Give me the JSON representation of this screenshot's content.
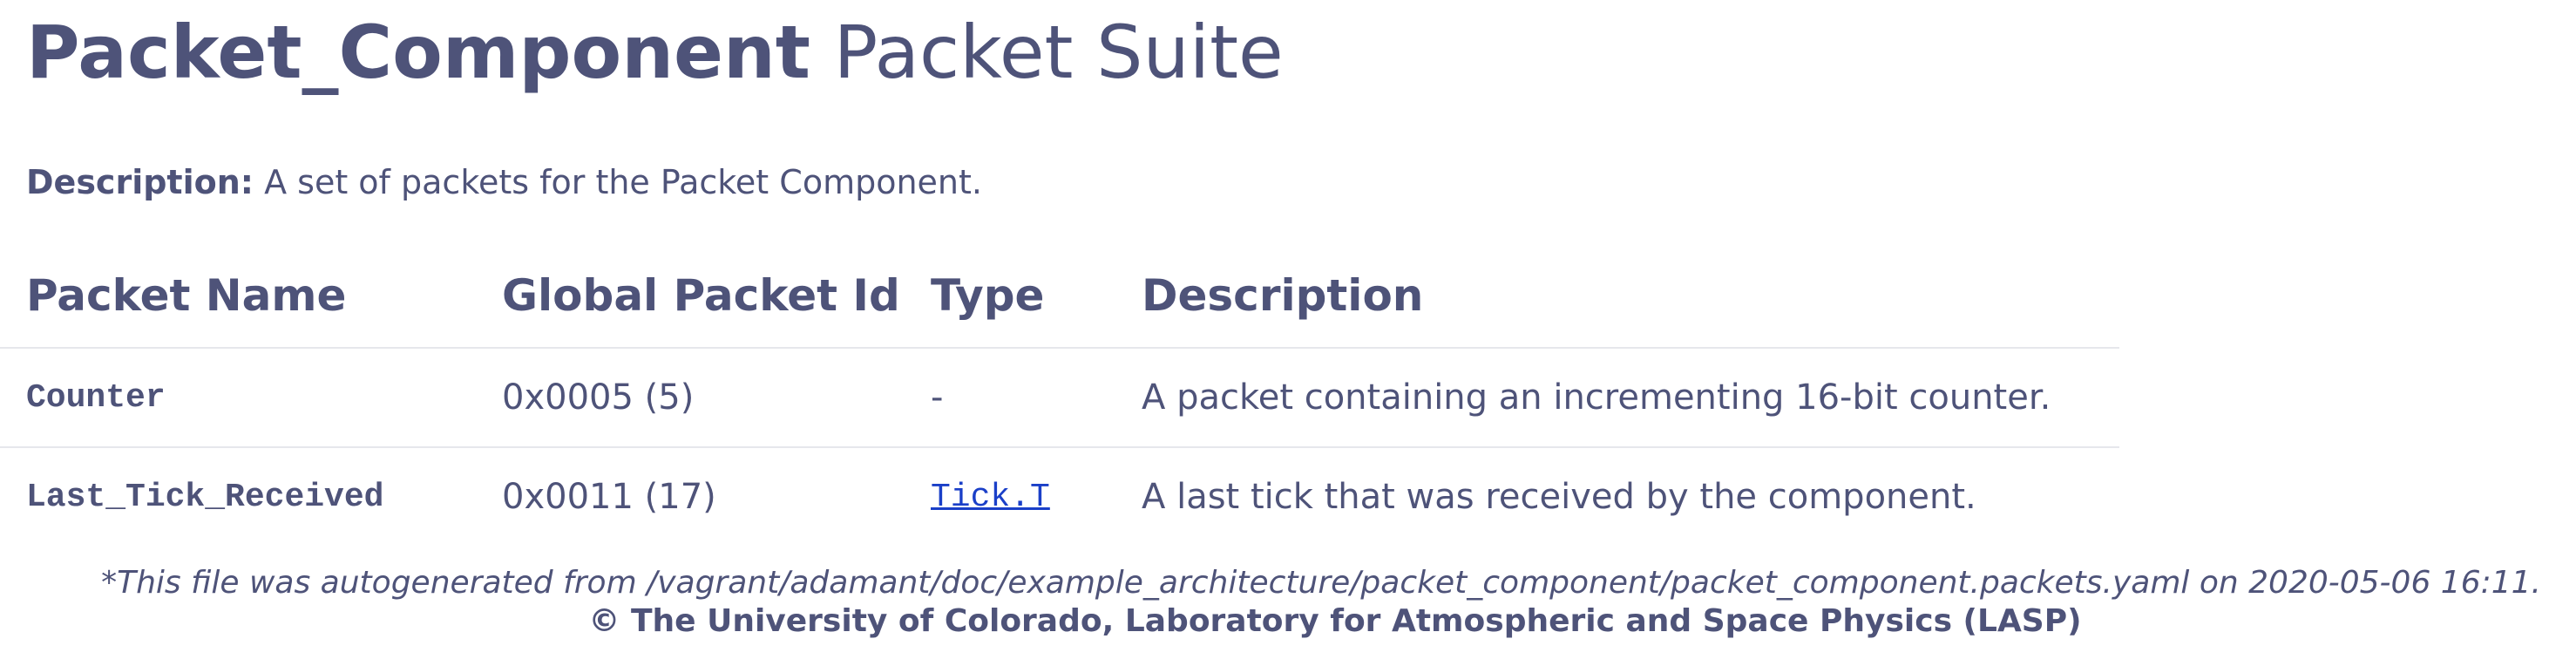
{
  "header": {
    "title_bold": "Packet_Component",
    "title_rest": "Packet Suite"
  },
  "description": {
    "label": "Description:",
    "text": "A set of packets for the Packet Component."
  },
  "table": {
    "columns": [
      "Packet Name",
      "Global Packet Id",
      "Type",
      "Description"
    ],
    "rows": [
      {
        "name": "Counter",
        "id": "0x0005 (5)",
        "type": "-",
        "type_is_link": false,
        "description": "A packet containing an incrementing 16-bit counter."
      },
      {
        "name": "Last_Tick_Received",
        "id": "0x0011 (17)",
        "type": "Tick.T",
        "type_is_link": true,
        "description": "A last tick that was received by the component."
      }
    ]
  },
  "footer": {
    "note": "*This file was autogenerated from /vagrant/adamant/doc/example_architecture/packet_component/packet_component.packets.yaml on 2020-05-06 16:11.",
    "copyright": "© The University of Colorado, Laboratory for Atmospheric and Space Physics (LASP)"
  },
  "colors": {
    "text": "#4e5379",
    "link": "#1a3fc8",
    "divider": "#e6e7ec"
  }
}
